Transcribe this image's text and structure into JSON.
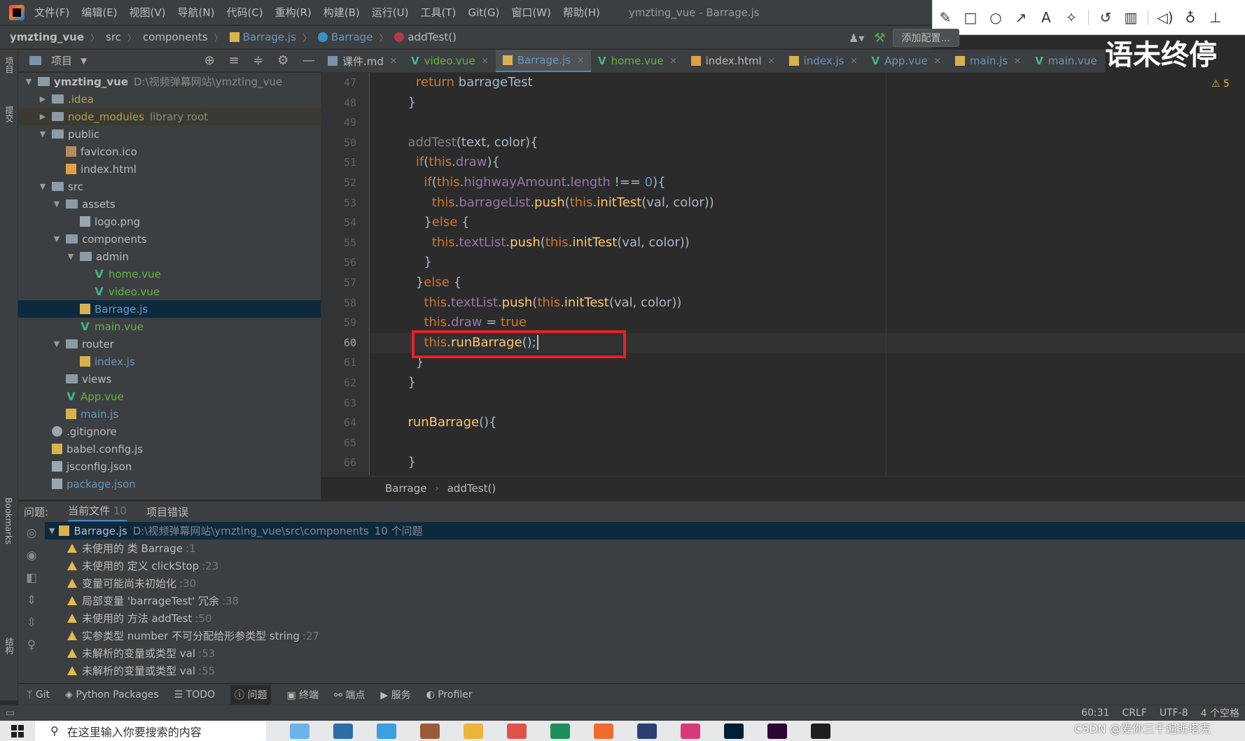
{
  "menu": {
    "items": [
      "文件(F)",
      "编辑(E)",
      "视图(V)",
      "导航(N)",
      "代码(C)",
      "重构(R)",
      "构建(B)",
      "运行(U)",
      "工具(T)",
      "Git(G)",
      "窗口(W)",
      "帮助(H)"
    ],
    "window_title": "ymzting_vue - Barrage.js"
  },
  "annotation_toolbar": {
    "icons": [
      "pencil-icon",
      "rectangle-icon",
      "circle-icon",
      "arrow-icon",
      "text-icon",
      "magic-wand-icon",
      "undo-icon",
      "trash-icon",
      "speaker-icon",
      "microphone-icon",
      "pin-icon"
    ]
  },
  "navbar": {
    "crumbs": [
      "ymzting_vue",
      "src",
      "components",
      "Barrage.js",
      "Barrage",
      "addTest()"
    ],
    "add_config": "添加配置...",
    "overlay_text": "语未终停"
  },
  "left_strip": {
    "project": "项目",
    "commit": "提交",
    "bookmarks": "Bookmarks",
    "structure": "结构"
  },
  "project_panel": {
    "title": "项目",
    "tree": [
      {
        "depth": 0,
        "kind": "folder",
        "name": "ymzting_vue",
        "extra": "D:\\视频弹幕网站\\ymzting_vue",
        "open": true,
        "bold": true
      },
      {
        "depth": 1,
        "kind": "folder",
        "name": ".idea",
        "open": false,
        "style": "ignored"
      },
      {
        "depth": 1,
        "kind": "folder",
        "name": "node_modules",
        "extra": "library root",
        "open": false,
        "style": "ignored",
        "hl": true
      },
      {
        "depth": 1,
        "kind": "folder",
        "name": "public",
        "open": true
      },
      {
        "depth": 2,
        "kind": "ico",
        "name": "favicon.ico"
      },
      {
        "depth": 2,
        "kind": "html",
        "name": "index.html"
      },
      {
        "depth": 1,
        "kind": "folder",
        "name": "src",
        "open": true
      },
      {
        "depth": 2,
        "kind": "folder",
        "name": "assets",
        "open": true
      },
      {
        "depth": 3,
        "kind": "img",
        "name": "logo.png"
      },
      {
        "depth": 2,
        "kind": "folder",
        "name": "components",
        "open": true
      },
      {
        "depth": 3,
        "kind": "folder",
        "name": "admin",
        "open": true
      },
      {
        "depth": 4,
        "kind": "vue",
        "name": "home.vue",
        "style": "vue-c"
      },
      {
        "depth": 4,
        "kind": "vue",
        "name": "video.vue",
        "style": "vue-c"
      },
      {
        "depth": 3,
        "kind": "js",
        "name": "Barrage.js",
        "style": "js-c",
        "sel": true
      },
      {
        "depth": 3,
        "kind": "vue",
        "name": "main.vue",
        "style": "vue-c"
      },
      {
        "depth": 2,
        "kind": "folder",
        "name": "router",
        "open": true
      },
      {
        "depth": 3,
        "kind": "js",
        "name": "index.js",
        "style": "js-c"
      },
      {
        "depth": 2,
        "kind": "folder",
        "name": "views",
        "leaf": true
      },
      {
        "depth": 2,
        "kind": "vue",
        "name": "App.vue",
        "style": "vue-c"
      },
      {
        "depth": 2,
        "kind": "js",
        "name": "main.js",
        "style": "js-c"
      },
      {
        "depth": 1,
        "kind": "git",
        "name": ".gitignore"
      },
      {
        "depth": 1,
        "kind": "js",
        "name": "babel.config.js"
      },
      {
        "depth": 1,
        "kind": "json",
        "name": "jsconfig.json"
      },
      {
        "depth": 1,
        "kind": "json",
        "name": "package.json",
        "style": "js-c"
      }
    ]
  },
  "tabs": [
    {
      "label": "课件.md",
      "icon": "md"
    },
    {
      "label": "video.vue",
      "icon": "vue",
      "style": "vue-c"
    },
    {
      "label": "Barrage.js",
      "icon": "js",
      "active": true
    },
    {
      "label": "home.vue",
      "icon": "vue",
      "style": "vue-c"
    },
    {
      "label": "index.html",
      "icon": "html"
    },
    {
      "label": "index.js",
      "icon": "js",
      "style": "js-c"
    },
    {
      "label": "App.vue",
      "icon": "vue",
      "style": "js-c"
    },
    {
      "label": "main.js",
      "icon": "js",
      "style": "js-c"
    },
    {
      "label": "main.vue",
      "icon": "vue",
      "style": "js-c"
    }
  ],
  "editor": {
    "line_numbers": [
      47,
      48,
      49,
      50,
      51,
      52,
      53,
      54,
      55,
      56,
      57,
      58,
      59,
      60,
      61,
      62,
      63,
      64,
      65,
      66
    ],
    "current_line": 60,
    "warning_count": "5",
    "lines": [
      [
        {
          "t": "    "
        },
        {
          "t": "return ",
          "c": "kw"
        },
        {
          "t": "barrageTest"
        }
      ],
      [
        {
          "t": "  }"
        }
      ],
      [
        {
          "t": ""
        }
      ],
      [
        {
          "t": "  "
        },
        {
          "t": "addTest",
          "c": "dim"
        },
        {
          "t": "(text, color){"
        }
      ],
      [
        {
          "t": "    "
        },
        {
          "t": "if",
          "c": "kw"
        },
        {
          "t": "("
        },
        {
          "t": "this",
          "c": "kw"
        },
        {
          "t": "."
        },
        {
          "t": "draw",
          "c": "prop"
        },
        {
          "t": "){"
        }
      ],
      [
        {
          "t": "      "
        },
        {
          "t": "if",
          "c": "kw"
        },
        {
          "t": "("
        },
        {
          "t": "this",
          "c": "kw"
        },
        {
          "t": "."
        },
        {
          "t": "highwayAmount",
          "c": "prop"
        },
        {
          "t": "."
        },
        {
          "t": "length",
          "c": "prop"
        },
        {
          "t": " !== "
        },
        {
          "t": "0",
          "c": "num"
        },
        {
          "t": "){"
        }
      ],
      [
        {
          "t": "        "
        },
        {
          "t": "this",
          "c": "kw"
        },
        {
          "t": "."
        },
        {
          "t": "barrageList",
          "c": "prop"
        },
        {
          "t": "."
        },
        {
          "t": "push",
          "c": "fn"
        },
        {
          "t": "("
        },
        {
          "t": "this",
          "c": "kw"
        },
        {
          "t": "."
        },
        {
          "t": "initTest",
          "c": "fn"
        },
        {
          "t": "(val, color))"
        }
      ],
      [
        {
          "t": "      }"
        },
        {
          "t": "else",
          "c": "kw"
        },
        {
          "t": " {"
        }
      ],
      [
        {
          "t": "        "
        },
        {
          "t": "this",
          "c": "kw"
        },
        {
          "t": "."
        },
        {
          "t": "textList",
          "c": "prop"
        },
        {
          "t": "."
        },
        {
          "t": "push",
          "c": "fn"
        },
        {
          "t": "("
        },
        {
          "t": "this",
          "c": "kw"
        },
        {
          "t": "."
        },
        {
          "t": "initTest",
          "c": "fn"
        },
        {
          "t": "(val, color))"
        }
      ],
      [
        {
          "t": "      }"
        }
      ],
      [
        {
          "t": "    }"
        },
        {
          "t": "else",
          "c": "kw"
        },
        {
          "t": " {"
        }
      ],
      [
        {
          "t": "      "
        },
        {
          "t": "this",
          "c": "kw"
        },
        {
          "t": "."
        },
        {
          "t": "textList",
          "c": "prop"
        },
        {
          "t": "."
        },
        {
          "t": "push",
          "c": "fn"
        },
        {
          "t": "("
        },
        {
          "t": "this",
          "c": "kw"
        },
        {
          "t": "."
        },
        {
          "t": "initTest",
          "c": "fn"
        },
        {
          "t": "(val, color))"
        }
      ],
      [
        {
          "t": "      "
        },
        {
          "t": "this",
          "c": "kw"
        },
        {
          "t": "."
        },
        {
          "t": "draw",
          "c": "prop"
        },
        {
          "t": " = "
        },
        {
          "t": "true",
          "c": "kw"
        }
      ],
      [
        {
          "t": "      "
        },
        {
          "t": "this",
          "c": "kw"
        },
        {
          "t": "."
        },
        {
          "t": "runBarrage",
          "c": "fn"
        },
        {
          "t": "();"
        }
      ],
      [
        {
          "t": "    }"
        }
      ],
      [
        {
          "t": "  }"
        }
      ],
      [
        {
          "t": ""
        }
      ],
      [
        {
          "t": "  "
        },
        {
          "t": "runBarrage",
          "c": "fn"
        },
        {
          "t": "(){"
        }
      ],
      [
        {
          "t": ""
        }
      ],
      [
        {
          "t": "  }"
        }
      ]
    ],
    "breadcrumbs": [
      "Barrage",
      "addTest()"
    ]
  },
  "problems": {
    "label": "问题:",
    "tabs": [
      {
        "label": "当前文件",
        "count": "10",
        "active": true
      },
      {
        "label": "项目错误"
      }
    ],
    "file": {
      "name": "Barrage.js",
      "path": "D:\\视频弹幕网站\\ymzting_vue\\src\\components",
      "count": "10 个问题"
    },
    "items": [
      {
        "text": "未使用的 类 Barrage",
        "line": ":1"
      },
      {
        "text": "未使用的 定义 clickStop",
        "line": ":23"
      },
      {
        "text": "变量可能尚未初始化",
        "line": ":30"
      },
      {
        "text": "局部变量 'barrageTest' 冗余",
        "line": ":38"
      },
      {
        "text": "未使用的 方法 addTest",
        "line": ":50"
      },
      {
        "text": "实参类型 number 不可分配给形参类型 string",
        "line": ":27"
      },
      {
        "text": "未解析的变量或类型 val",
        "line": ":53"
      },
      {
        "text": "未解析的变量或类型 val",
        "line": ":55"
      }
    ]
  },
  "bottom_tools": [
    {
      "label": "Git",
      "icon": "git-branch-icon"
    },
    {
      "label": "Python Packages",
      "icon": "layers-icon"
    },
    {
      "label": "TODO",
      "icon": "list-icon"
    },
    {
      "label": "问题",
      "icon": "info-icon",
      "active": true
    },
    {
      "label": "终端",
      "icon": "terminal-icon"
    },
    {
      "label": "端点",
      "icon": "endpoints-icon"
    },
    {
      "label": "服务",
      "icon": "play-icon"
    },
    {
      "label": "Profiler",
      "icon": "profiler-icon"
    }
  ],
  "status": {
    "position": "60:31",
    "line_sep": "CRLF",
    "encoding": "UTF-8",
    "indent": "4 个空格"
  },
  "taskbar": {
    "search_placeholder": "在这里输入你要搜索的内容",
    "watermark": "CSDN @爱你三千遍斯塔克"
  },
  "colors": {
    "accent": "#4a88c7",
    "highlight_box": "#e8202a",
    "warning": "#e6b94a"
  }
}
